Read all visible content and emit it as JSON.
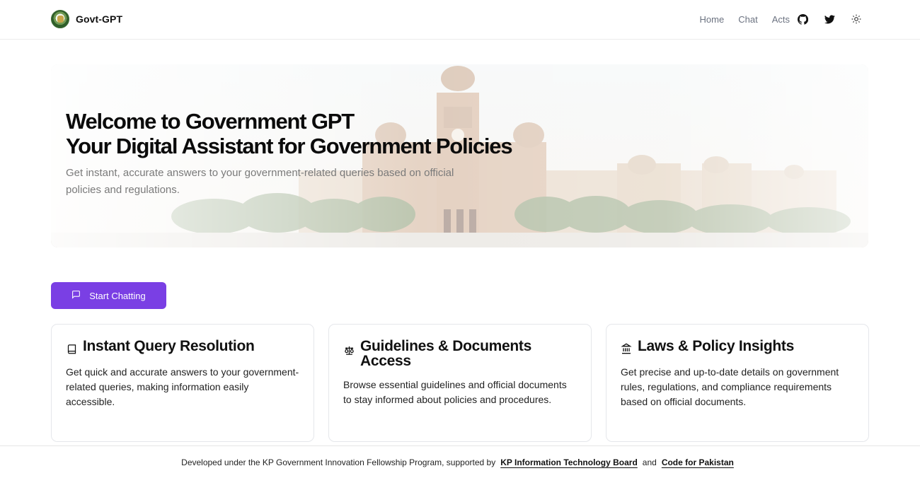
{
  "header": {
    "brand": "Govt-GPT",
    "nav": [
      "Home",
      "Chat",
      "Acts"
    ],
    "icons": [
      "github-icon",
      "twitter-icon",
      "sun-icon"
    ]
  },
  "hero": {
    "title_line1": "Welcome to Government GPT",
    "title_line2": "Your Digital Assistant for Government Policies",
    "subtitle": "Get instant, accurate answers to your government-related queries based on official policies and regulations."
  },
  "cta": {
    "label": "Start Chatting"
  },
  "cards": [
    {
      "title": "Instant Query Resolution",
      "text": "Get quick and accurate answers to your government-related queries, making information easily accessible.",
      "icon": "book-icon"
    },
    {
      "title": "Guidelines & Documents Access",
      "text": "Browse essential guidelines and official documents to stay informed about policies and procedures.",
      "icon": "scale-icon"
    },
    {
      "title": "Laws & Policy Insights",
      "text": "Get precise and up-to-date details on government rules, regulations, and compliance requirements based on official documents.",
      "icon": "landmark-icon"
    }
  ],
  "footer": {
    "prefix": "Developed under the KP Government Innovation Fellowship Program, supported by",
    "link1": "KP Information Technology Board",
    "conj": "and",
    "link2": "Code for Pakistan"
  },
  "colors": {
    "accent": "#7a3fe4"
  }
}
